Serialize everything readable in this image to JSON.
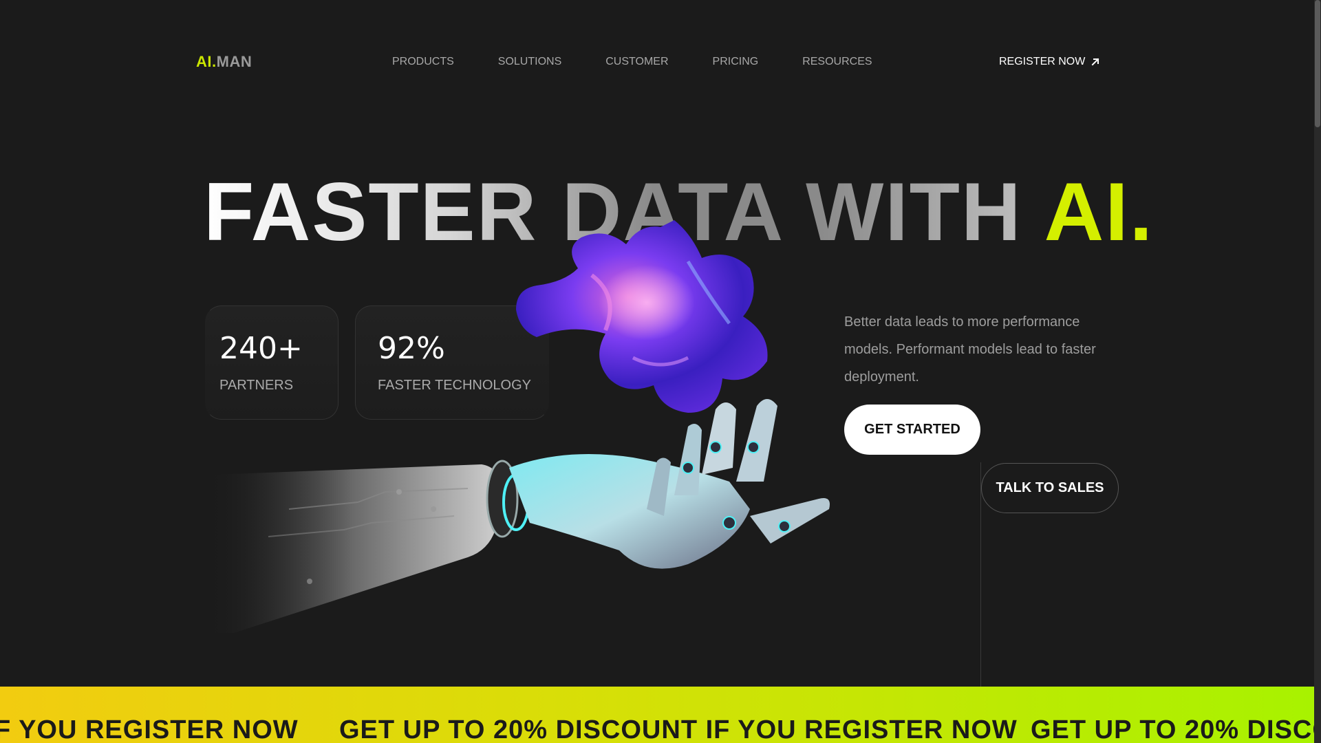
{
  "header": {
    "logo_accent": "AI.",
    "logo_rest": "MAN",
    "nav": [
      "PRODUCTS",
      "SOLUTIONS",
      "CUSTOMER",
      "PRICING",
      "RESOURCES"
    ],
    "register_label": "REGISTER NOW"
  },
  "hero": {
    "headline_main": "FASTER DATA WITH",
    "headline_accent": "AI.",
    "stats": [
      {
        "value": "240+",
        "label": "PARTNERS"
      },
      {
        "value": "92%",
        "label": "FASTER TECHNOLOGY"
      }
    ],
    "description": "Better data leads to more performance models. Performant models lead to faster deployment.",
    "primary_button": "GET STARTED",
    "secondary_button": "TALK TO SALES"
  },
  "banner": {
    "text_partial_left": "F YOU REGISTER NOW",
    "text_full": "GET UP TO 20% DISCOUNT IF YOU REGISTER NOW",
    "text_partial_right": "GET UP TO 20% DISCO"
  },
  "colors": {
    "accent": "#d4ef00",
    "background": "#1b1b1b",
    "banner_start": "#f2cc10",
    "banner_end": "#a8f200"
  },
  "icons": [
    "arrow-up-right-icon",
    "robot-hand-icon",
    "crystal-blob-icon"
  ]
}
